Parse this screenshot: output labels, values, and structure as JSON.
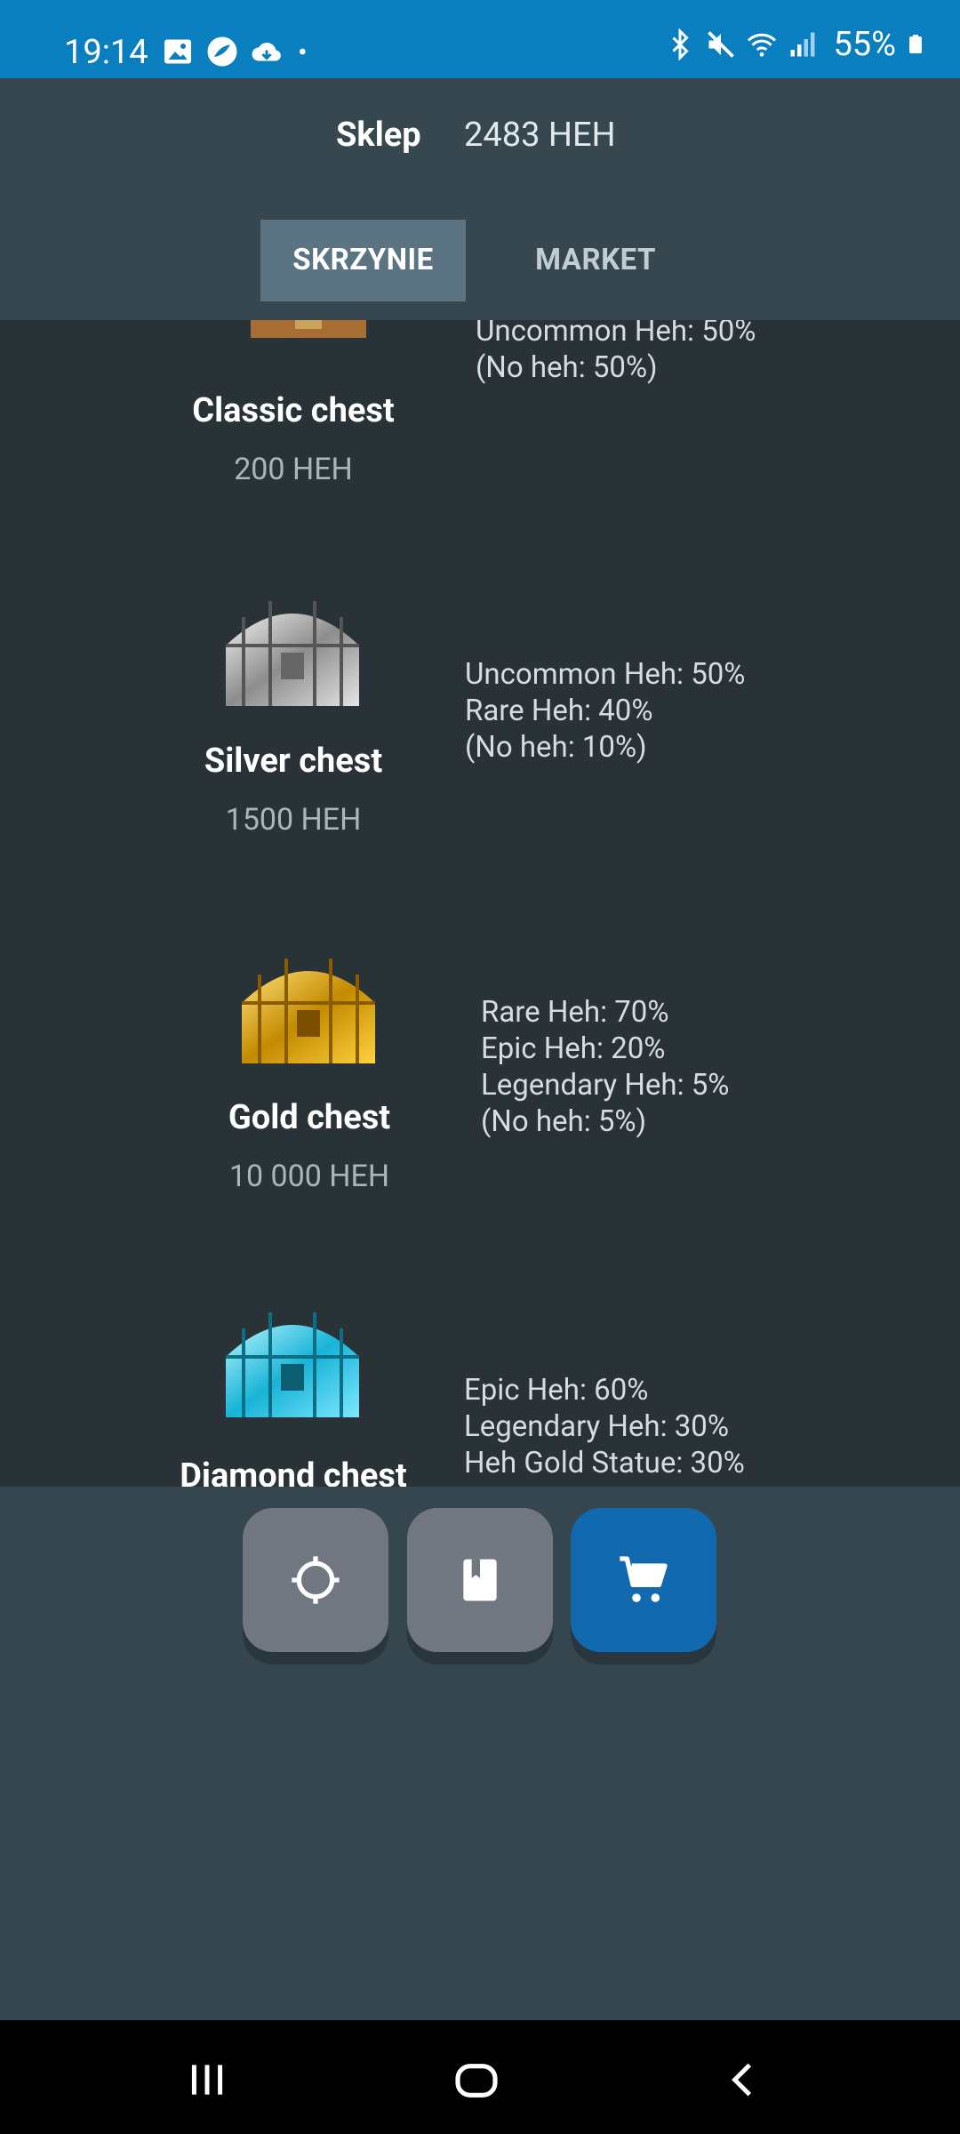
{
  "status_bar": {
    "time": "19:14",
    "battery": "55%",
    "icons_left": [
      "gallery-icon",
      "app-icon",
      "cloud-icon",
      "dot-icon"
    ],
    "icons_right": [
      "bluetooth-icon",
      "mute-icon",
      "wifi-icon",
      "signal-icon",
      "battery-icon"
    ]
  },
  "header": {
    "title": "Sklep",
    "balance": "2483 HEH"
  },
  "tabs": [
    {
      "label": "SKRZYNIE",
      "active": true
    },
    {
      "label": "MARKET",
      "active": false
    }
  ],
  "chests": [
    {
      "name": "Classic chest",
      "price": "200 HEH",
      "icon": "classic-chest-icon",
      "odds": [
        "Uncommon Heh: 50%",
        "(No heh: 50%)"
      ]
    },
    {
      "name": "Silver chest",
      "price": "1500 HEH",
      "icon": "silver-chest-icon",
      "odds": [
        "Uncommon Heh: 50%",
        "Rare Heh: 40%",
        "(No heh: 10%)"
      ]
    },
    {
      "name": "Gold chest",
      "price": "10 000 HEH",
      "icon": "gold-chest-icon",
      "odds": [
        "Rare Heh: 70%",
        "Epic Heh: 20%",
        "Legendary Heh: 5%",
        "(No heh: 5%)"
      ]
    },
    {
      "name": "Diamond chest",
      "price": "",
      "icon": "diamond-chest-icon",
      "odds": [
        "Epic Heh: 60%",
        "Legendary Heh: 30%",
        "Heh Gold Statue: 30%"
      ]
    }
  ],
  "bottom_nav": [
    {
      "icon": "crosshair-icon",
      "active": false
    },
    {
      "icon": "book-icon",
      "active": false
    },
    {
      "icon": "cart-icon",
      "active": true
    }
  ],
  "system_nav": [
    "recents-icon",
    "home-icon",
    "back-icon"
  ],
  "colors": {
    "status_bar": "#0a7fc0",
    "header_bg": "#37474f",
    "list_bg": "#283237",
    "tab_active": "#5c7482",
    "nav_active": "#1169b0",
    "nav_inactive": "#707780"
  }
}
